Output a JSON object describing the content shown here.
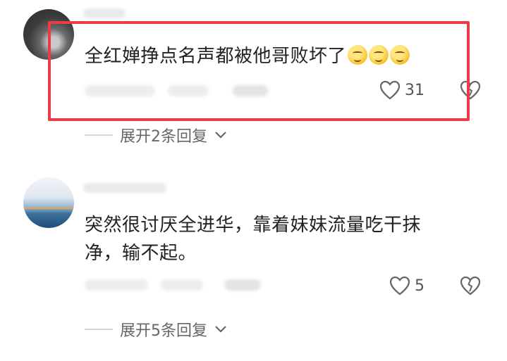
{
  "comments": [
    {
      "text": "全红婵挣点名声都被他哥败坏了",
      "emoji": [
        "🤭",
        "🤭",
        "🤭"
      ],
      "likes": "31",
      "expand_label": "展开2条回复"
    },
    {
      "text_lines": [
        "突然很讨厌全进华，靠着妹妹流量吃干抹",
        "净，输不起。"
      ],
      "likes": "5",
      "expand_label": "展开5条回复"
    }
  ],
  "colors": {
    "highlight_border": "#ea3b47",
    "text": "#222222",
    "muted": "#666666"
  },
  "icons": {
    "like": "heart-outline-icon",
    "dislike": "broken-heart-icon",
    "expand": "chevron-down-icon"
  }
}
